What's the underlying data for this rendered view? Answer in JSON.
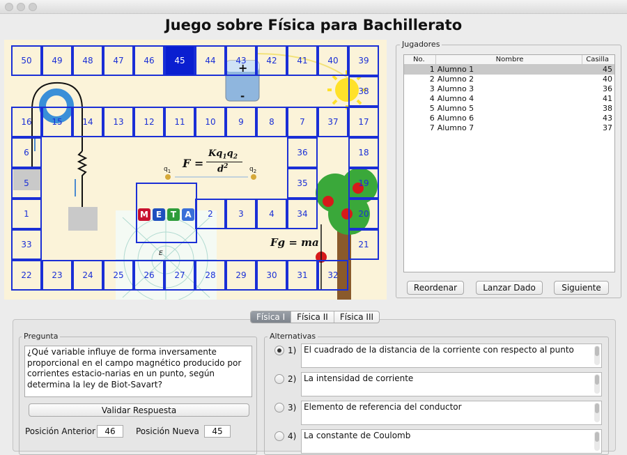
{
  "window": {
    "title": "Juego sobre Física para Bachillerato"
  },
  "board": {
    "cells": [
      {
        "n": "50"
      },
      {
        "n": "49"
      },
      {
        "n": "48"
      },
      {
        "n": "47"
      },
      {
        "n": "46"
      },
      {
        "n": "45",
        "active": true
      },
      {
        "n": "44"
      },
      {
        "n": "43"
      },
      {
        "n": "42"
      },
      {
        "n": "41"
      },
      {
        "n": "40"
      },
      {
        "n": "39"
      },
      {
        "n": "38"
      },
      {
        "n": "16"
      },
      {
        "n": "15"
      },
      {
        "n": "14"
      },
      {
        "n": "13"
      },
      {
        "n": "12"
      },
      {
        "n": "11"
      },
      {
        "n": "10"
      },
      {
        "n": "9"
      },
      {
        "n": "8"
      },
      {
        "n": "7"
      },
      {
        "n": "37"
      },
      {
        "n": "17"
      },
      {
        "n": "6"
      },
      {
        "n": "36"
      },
      {
        "n": "18"
      },
      {
        "n": "5"
      },
      {
        "n": "35"
      },
      {
        "n": "19"
      },
      {
        "n": "1"
      },
      {
        "n": "2"
      },
      {
        "n": "3"
      },
      {
        "n": "4"
      },
      {
        "n": "34"
      },
      {
        "n": "20"
      },
      {
        "n": "33"
      },
      {
        "n": "21"
      },
      {
        "n": "22"
      },
      {
        "n": "23"
      },
      {
        "n": "24"
      },
      {
        "n": "25"
      },
      {
        "n": "26"
      },
      {
        "n": "27"
      },
      {
        "n": "28"
      },
      {
        "n": "29"
      },
      {
        "n": "30"
      },
      {
        "n": "31"
      },
      {
        "n": "32"
      }
    ],
    "meta_letters": [
      "M",
      "E",
      "T",
      "A"
    ],
    "meta_colors": [
      "#c8102e",
      "#1f4fbf",
      "#2e9c3a",
      "#3a6fd8"
    ],
    "formula_coulomb_left": "F =",
    "formula_numerator": "Kq",
    "formula_numerator_sub1": "1",
    "formula_numerator_mid": "q",
    "formula_numerator_sub2": "2",
    "formula_denominator": "d",
    "formula_denominator_sup": "2",
    "formula_newton": "Fg = ma",
    "charge_q1": "q",
    "charge_q1_sub": "1",
    "charge_q2": "q",
    "charge_q2_sub": "2",
    "plus_sign": "+",
    "minus_sign": "-",
    "field_label": "E"
  },
  "players": {
    "legend": "Jugadores",
    "columns": [
      "No.",
      "Nombre",
      "Casilla"
    ],
    "rows": [
      {
        "no": "1",
        "name": "Alumno 1",
        "cell": "45",
        "selected": true
      },
      {
        "no": "2",
        "name": "Alumno 2",
        "cell": "40"
      },
      {
        "no": "3",
        "name": "Alumno 3",
        "cell": "36"
      },
      {
        "no": "4",
        "name": "Alumno 4",
        "cell": "41"
      },
      {
        "no": "5",
        "name": "Alumno 5",
        "cell": "38"
      },
      {
        "no": "6",
        "name": "Alumno 6",
        "cell": "43"
      },
      {
        "no": "7",
        "name": "Alumno 7",
        "cell": "37"
      }
    ],
    "buttons": {
      "reorder": "Reordenar",
      "roll": "Lanzar Dado",
      "next": "Siguiente"
    }
  },
  "tabs": [
    {
      "label": "Física I",
      "active": true
    },
    {
      "label": "Física II"
    },
    {
      "label": "Física III"
    }
  ],
  "question": {
    "legend": "Pregunta",
    "text": "¿Qué variable influye de forma inversamente proporcional en el campo magnético producido por corrientes estacio-narias en un punto, según determina la ley de Biot-Savart?",
    "validate": "Validar Respuesta",
    "prev_label": "Posición Anterior",
    "prev_value": "46",
    "new_label": "Posición Nueva",
    "new_value": "45"
  },
  "alternatives": {
    "legend": "Alternativas",
    "items": [
      {
        "num": "1)",
        "text": "El cuadrado de la distancia de la corriente con respecto al punto",
        "checked": true
      },
      {
        "num": "2)",
        "text": "La intensidad de corriente"
      },
      {
        "num": "3)",
        "text": "Elemento de referencia del conductor"
      },
      {
        "num": "4)",
        "text": "La constante de Coulomb"
      }
    ]
  }
}
